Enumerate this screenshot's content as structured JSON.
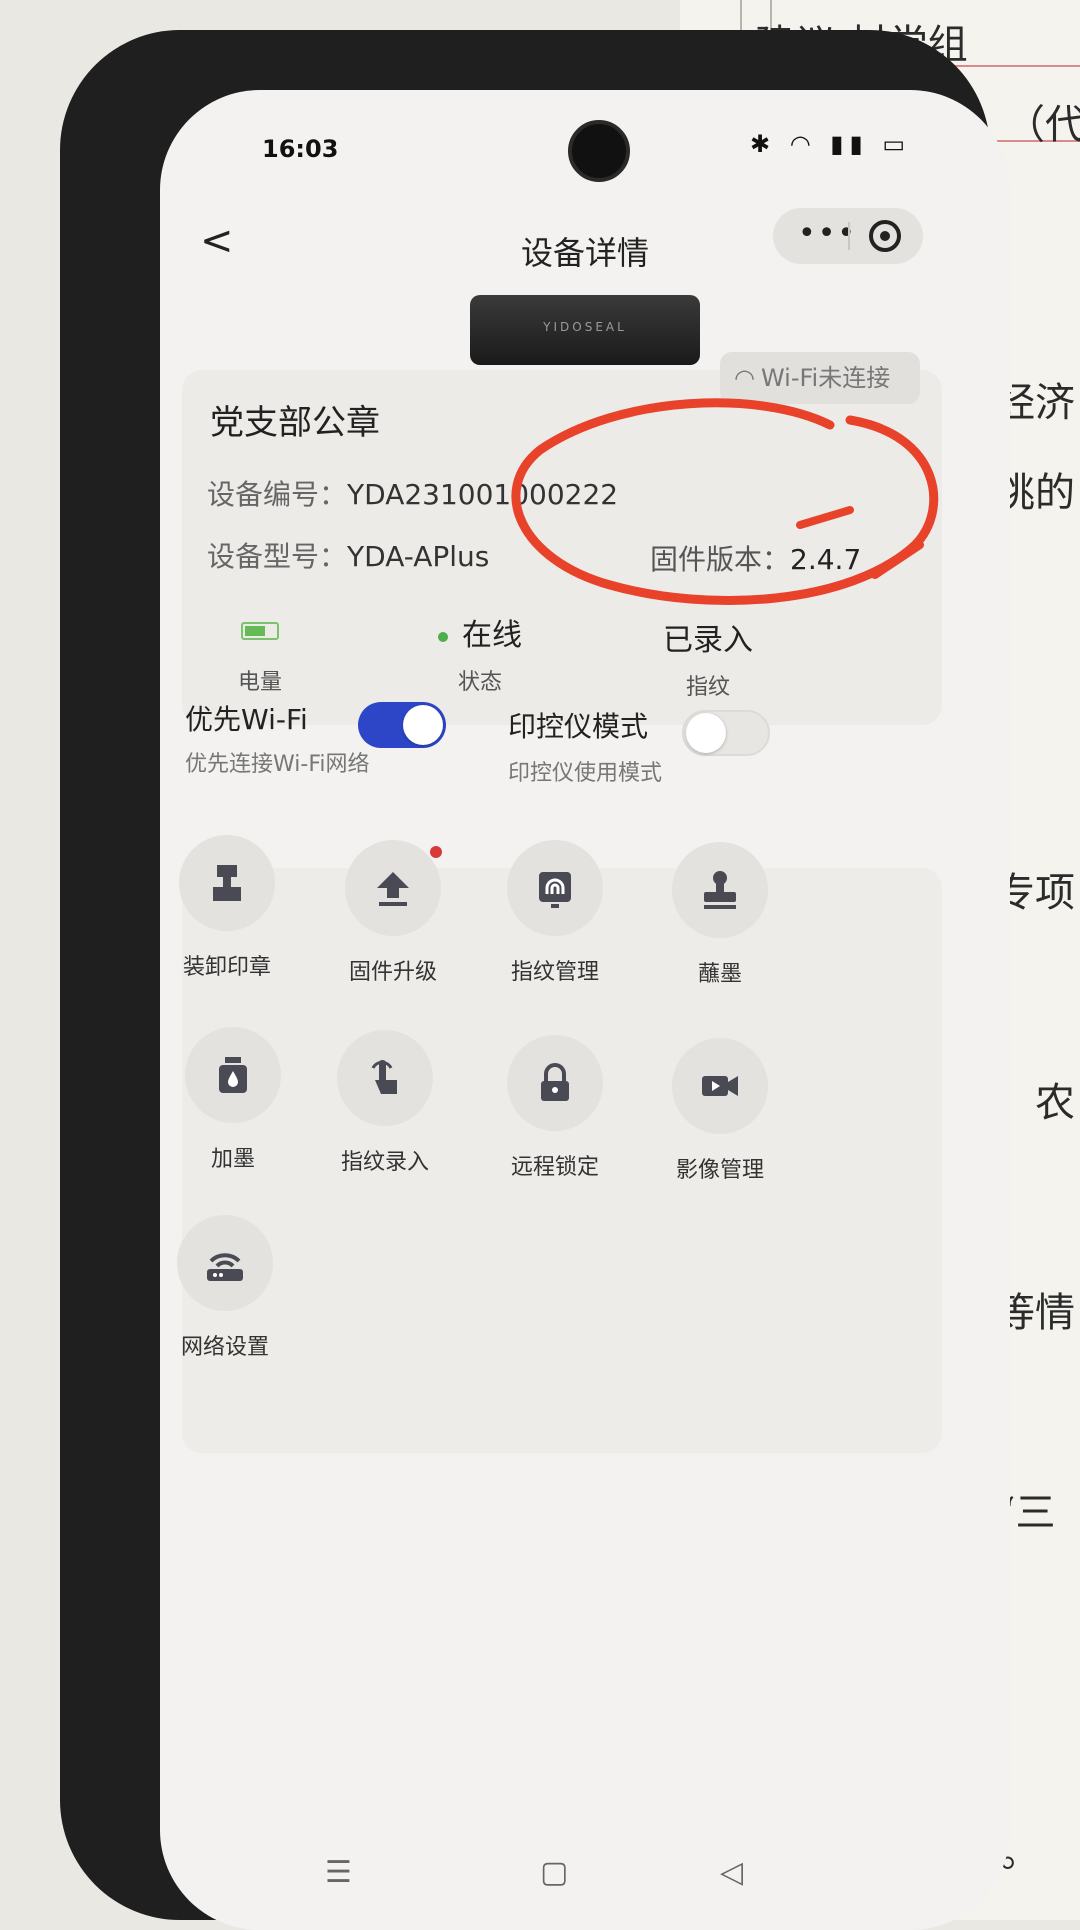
{
  "paper": {
    "lines": [
      "建议  村党组",
      "（代",
      "经济",
      "挑的",
      "专项",
      "、农",
      "等情",
      "“三",
      "。"
    ]
  },
  "status_bar": {
    "time": "16:03",
    "icons": "✱ ◠ ▮▮ ▭"
  },
  "header": {
    "back": "<",
    "title": "设备详情",
    "more": "•••"
  },
  "device": {
    "logo": "YIDOSEAL",
    "wifi_status": "Wi-Fi未连接",
    "name": "党支部公章",
    "serial_label": "设备编号：",
    "serial_value": "YDA231001000222",
    "model_label": "设备型号：",
    "model_value": "YDA-APlus",
    "firmware_label": "固件版本：",
    "firmware_value": "2.4.7"
  },
  "stats": [
    {
      "value": "",
      "label": "电量"
    },
    {
      "value": "在线",
      "label": "状态"
    },
    {
      "value": "已录入",
      "label": "指纹"
    }
  ],
  "toggles": {
    "wifi": {
      "title": "优先Wi-Fi",
      "sub": "优先连接Wi-Fi网络",
      "on": true
    },
    "printer": {
      "title": "印控仪模式",
      "sub": "印控仪使用模式",
      "on": false
    }
  },
  "grid": [
    {
      "label": "装卸印章",
      "icon": "seal-mount-icon"
    },
    {
      "label": "固件升级",
      "icon": "upload-icon"
    },
    {
      "label": "指纹管理",
      "icon": "fingerprint-icon"
    },
    {
      "label": "蘸墨",
      "icon": "stamp-icon"
    },
    {
      "label": "加墨",
      "icon": "ink-drop-icon"
    },
    {
      "label": "指纹录入",
      "icon": "finger-press-icon"
    },
    {
      "label": "远程锁定",
      "icon": "lock-icon"
    },
    {
      "label": "影像管理",
      "icon": "video-icon"
    },
    {
      "label": "网络设置",
      "icon": "router-icon"
    }
  ],
  "nav": {
    "menu": "☰",
    "home": "▢",
    "back": "◁"
  },
  "colors": {
    "accent": "#2d46c8",
    "online": "#4cae4c",
    "annotation": "#e8432a",
    "badge": "#d63a3a"
  }
}
